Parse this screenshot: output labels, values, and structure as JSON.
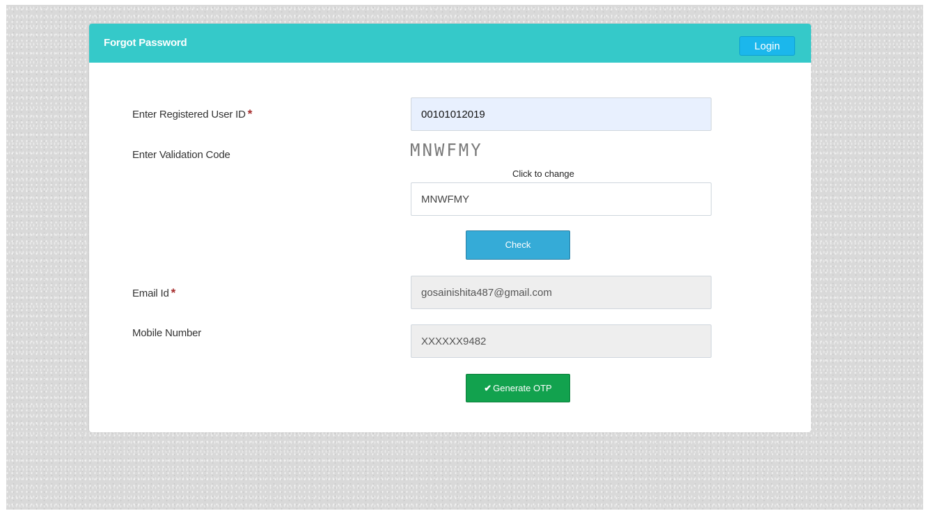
{
  "panel": {
    "title": "Forgot Password",
    "login_label": "Login"
  },
  "form": {
    "user_id": {
      "label": "Enter Registered User ID",
      "required_mark": "*",
      "value": "00101012019"
    },
    "validation": {
      "label": "Enter Validation Code",
      "captcha_text": "MNWFMY",
      "hint": "Click to change",
      "value": "MNWFMY"
    },
    "check_label": "Check",
    "email": {
      "label": "Email Id",
      "required_mark": "*",
      "value": "gosainishita487@gmail.com"
    },
    "mobile": {
      "label": "Mobile Number",
      "value": "XXXXXX9482"
    },
    "generate_otp_label": "Generate OTP",
    "generate_otp_icon": "check-icon"
  },
  "colors": {
    "header": "#35c9c9",
    "login_button": "#1bb7ec",
    "check_button": "#35abd7",
    "otp_button": "#12a24e",
    "required": "#a52a2a"
  }
}
